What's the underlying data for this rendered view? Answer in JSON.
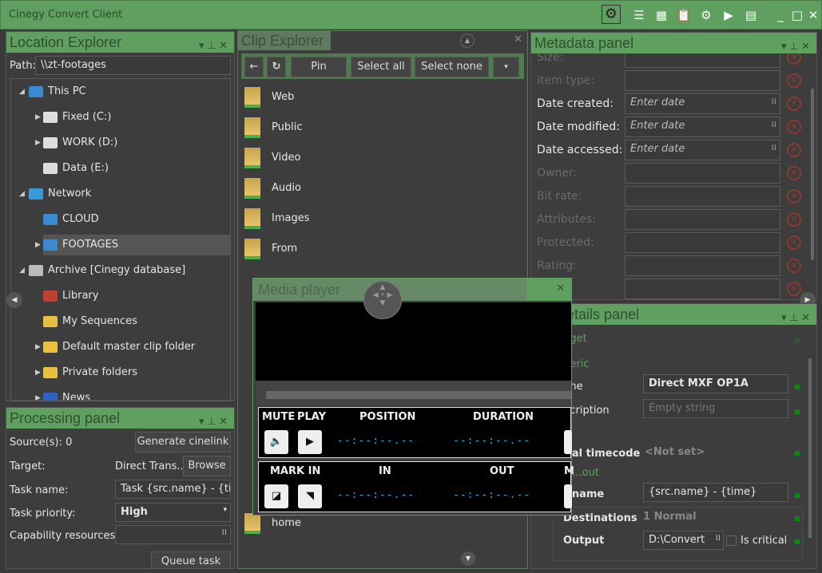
{
  "app": {
    "title": "Cinegy Convert Client",
    "toolbar_icons": [
      "gear-icon",
      "align-icon",
      "grid-icon",
      "clipboard-icon",
      "cogs-icon",
      "play-icon",
      "list-icon"
    ],
    "window_controls": [
      "minimize",
      "maximize",
      "close"
    ]
  },
  "colors": {
    "accent": "#5fa060",
    "timecode": "#2aa8e0",
    "clear": "#8a3a30"
  },
  "location": {
    "title": "Location Explorer",
    "path_label": "Path:",
    "path_value": "\\\\zt-footages",
    "tree": [
      {
        "label": "This PC",
        "level": 0,
        "exp": "open",
        "icon": "computer"
      },
      {
        "label": "Fixed (C:)",
        "level": 1,
        "exp": "closed",
        "icon": "drive"
      },
      {
        "label": "WORK (D:)",
        "level": 1,
        "exp": "closed",
        "icon": "drive"
      },
      {
        "label": "Data (E:)",
        "level": 1,
        "exp": "",
        "icon": "drive"
      },
      {
        "label": "Network",
        "level": 0,
        "exp": "open",
        "icon": "network"
      },
      {
        "label": "CLOUD",
        "level": 1,
        "exp": "",
        "icon": "computer"
      },
      {
        "label": "FOOTAGES",
        "level": 1,
        "exp": "closed",
        "icon": "computer",
        "selected": true
      },
      {
        "label": "Archive [Cinegy database]",
        "level": 0,
        "exp": "open",
        "icon": "database"
      },
      {
        "label": "Library",
        "level": 1,
        "exp": "",
        "icon": "home"
      },
      {
        "label": "My Sequences",
        "level": 1,
        "exp": "",
        "icon": "folder"
      },
      {
        "label": "Default master clip folder",
        "level": 1,
        "exp": "closed",
        "icon": "folder"
      },
      {
        "label": "Private folders",
        "level": 1,
        "exp": "closed",
        "icon": "folder"
      },
      {
        "label": "News",
        "level": 1,
        "exp": "closed",
        "icon": "news"
      }
    ]
  },
  "processing": {
    "title": "Processing panel",
    "sources": "Source(s): 0",
    "generate": "Generate cinelink",
    "target_label": "Target:",
    "target_value": "Direct Trans...",
    "browse": "Browse",
    "task_name_label": "Task name:",
    "task_name_value": "Task {src.name} - {tim",
    "priority_label": "Task priority:",
    "priority_value": "High",
    "capability_label": "Capability resources:",
    "queue": "Queue task"
  },
  "clip": {
    "title": "Clip Explorer",
    "pin": "Pin",
    "select_all": "Select all",
    "select_none": "Select none",
    "folders": [
      "Web",
      "Public",
      "Video",
      "Audio",
      "Images",
      "From"
    ],
    "last_folder": "home"
  },
  "metadata": {
    "title": "Metadata panel",
    "rows": [
      {
        "label": "Size:",
        "enabled": false,
        "value": ""
      },
      {
        "label": "Item type:",
        "enabled": false,
        "value": ""
      },
      {
        "label": "Date created:",
        "enabled": true,
        "value": "Enter date"
      },
      {
        "label": "Date modified:",
        "enabled": true,
        "value": "Enter date"
      },
      {
        "label": "Date accessed:",
        "enabled": true,
        "value": "Enter date"
      },
      {
        "label": "Owner:",
        "enabled": false,
        "value": ""
      },
      {
        "label": "Bit rate:",
        "enabled": false,
        "value": ""
      },
      {
        "label": "Attributes:",
        "enabled": false,
        "value": ""
      },
      {
        "label": "Protected:",
        "enabled": false,
        "value": ""
      },
      {
        "label": "Rating:",
        "enabled": false,
        "value": ""
      },
      {
        "label": "",
        "enabled": false,
        "value": ""
      }
    ]
  },
  "profile": {
    "title": "...e details panel",
    "target": "...get",
    "generic": "...eric",
    "name_label": "...ne",
    "name_value": "Direct MXF OP1A",
    "desc_label": "...cription",
    "desc_value": "Empty string",
    "tc_label": "...al timecode",
    "tc_value": "<Not set>",
    "output_section": "M...out",
    "fname_label": "...name",
    "fname_value": "{src.name} - {time}",
    "dest_label": "Destinations",
    "dest_value": "1 Normal",
    "output_label": "Output",
    "output_value": "D:\\Convert",
    "critical": "Is critical"
  },
  "player": {
    "title": "Media player",
    "mute": "MUTE",
    "play": "PLAY",
    "position": "POSITION",
    "duration": "DURATION",
    "mark_in": "MARK IN",
    "in": "IN",
    "out": "OUT",
    "mark_out": "M",
    "position_tc": "--:--:--.--",
    "duration_tc": "--:--:--.--",
    "in_tc": "--:--:--.--",
    "out_tc": "--:--:--.--"
  }
}
